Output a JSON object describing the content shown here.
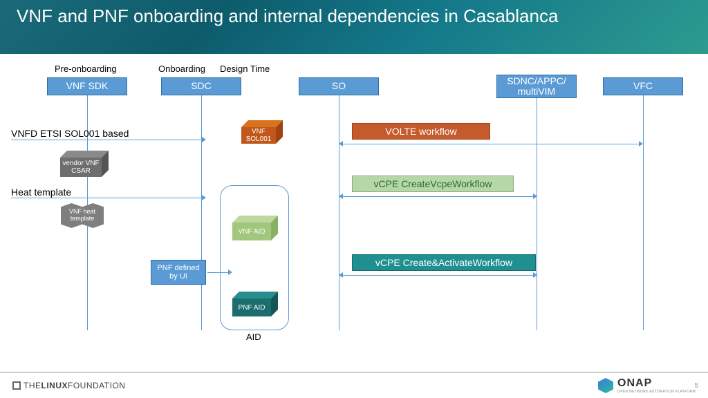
{
  "title": "VNF and PNF onboarding and internal dependencies in Casablanca",
  "labels": {
    "pre_onboarding": "Pre-onboarding",
    "onboarding": "Onboarding",
    "design_time": "Design Time",
    "vnfd_etsi": "VNFD ETSI SOL001 based",
    "heat_template": "Heat template",
    "aid": "AID"
  },
  "top_boxes": {
    "vnf_sdk": "VNF SDK",
    "sdc": "SDC",
    "so": "SO",
    "sdnc_appc": "SDNC/APPC/ multiVIM",
    "vfc": "VFC"
  },
  "cubes": {
    "vnf_sol001": "VNF SOL001",
    "vendor_csar": "vendor VNF CSAR",
    "vnf_heat": "VNF heat template",
    "vnf_aid": "VNF AID",
    "pnf_aid": "PNF AID",
    "pnf_ui": "PNF defined by UI"
  },
  "workflows": {
    "volte": "VOLTE workflow",
    "vcpe_create": "vCPE CreateVcpeWorkflow",
    "vcpe_activate": "vCPE Create&ActivateWorkflow"
  },
  "footer": {
    "linux_the": "THE",
    "linux_main": "LINUX",
    "linux_found": "FOUNDATION",
    "onap": "ONAP",
    "onap_sub": "OPEN NETWORK AUTOMATION PLATFORM",
    "page": "5"
  }
}
